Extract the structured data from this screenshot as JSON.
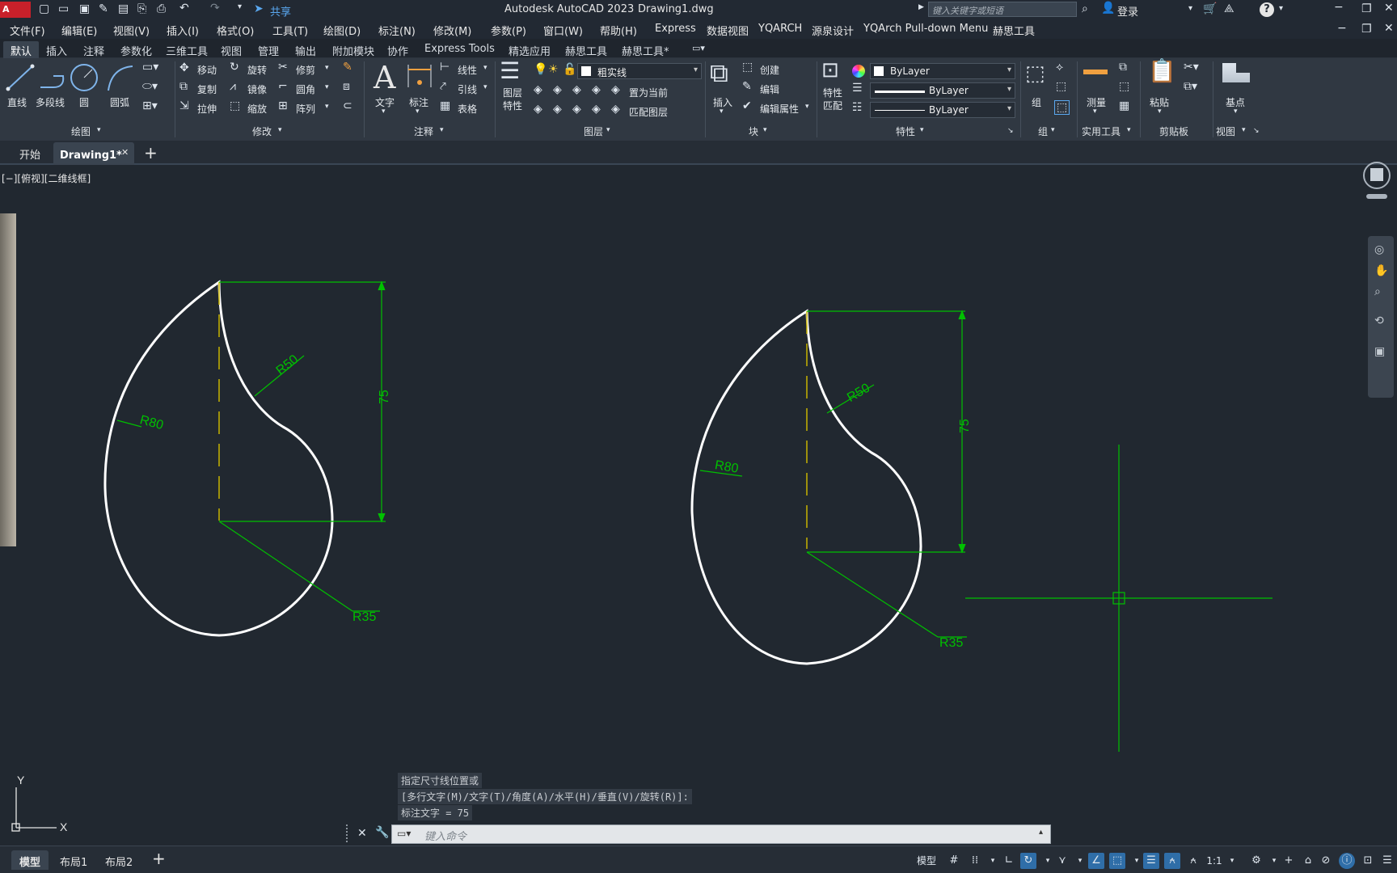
{
  "title_bar": {
    "app_logo": "A CAD",
    "share_label": "共享",
    "title": "Autodesk AutoCAD 2023",
    "document": "Drawing1.dwg",
    "search_placeholder": "键入关键字或短语",
    "login_label": "登录"
  },
  "menu": [
    "文件(F)",
    "编辑(E)",
    "视图(V)",
    "插入(I)",
    "格式(O)",
    "工具(T)",
    "绘图(D)",
    "标注(N)",
    "修改(M)",
    "参数(P)",
    "窗口(W)",
    "帮助(H)",
    "Express",
    "数据视图",
    "YQARCH",
    "源泉设计",
    "YQArch Pull-down Menu",
    "赫思工具"
  ],
  "ribbon_tabs": [
    "默认",
    "插入",
    "注释",
    "参数化",
    "三维工具",
    "视图",
    "管理",
    "输出",
    "附加模块",
    "协作",
    "Express Tools",
    "精选应用",
    "赫思工具",
    "赫思工具*"
  ],
  "ribbon": {
    "draw": {
      "line": "直线",
      "polyline": "多段线",
      "circle": "圆",
      "arc": "圆弧",
      "panel": "绘图"
    },
    "modify": {
      "move": "移动",
      "rotate": "旋转",
      "trim": "修剪",
      "copy": "复制",
      "mirror": "镜像",
      "fillet": "圆角",
      "stretch": "拉伸",
      "scale": "缩放",
      "array": "阵列",
      "panel": "修改"
    },
    "annotation": {
      "text": "文字",
      "dimension": "标注",
      "linear": "线性",
      "leader": "引线",
      "table": "表格",
      "panel": "注释"
    },
    "layers": {
      "properties_line1": "图层",
      "properties_line2": "特性",
      "current_layer": "粗实线",
      "set_current": "置为当前",
      "match_layer": "匹配图层",
      "panel": "图层"
    },
    "block": {
      "insert": "插入",
      "create": "创建",
      "edit": "编辑",
      "edit_attributes": "编辑属性",
      "panel": "块"
    },
    "properties": {
      "match_line1": "特性",
      "match_line2": "匹配",
      "color": "ByLayer",
      "linetype": "ByLayer",
      "lineweight": "ByLayer",
      "panel": "特性"
    },
    "groups": {
      "group": "组",
      "panel": "组"
    },
    "utilities": {
      "measure": "测量",
      "panel": "实用工具"
    },
    "clipboard": {
      "paste": "粘贴",
      "panel": "剪贴板"
    },
    "view": {
      "base": "基点",
      "panel": "视图"
    }
  },
  "doc_tabs": {
    "start": "开始",
    "drawing": "Drawing1*"
  },
  "viewport_label": "[−][俯视][二维线框]",
  "drawing_left": {
    "r50": "R50",
    "r80": "R80",
    "r35": "R35",
    "dim": "75"
  },
  "drawing_right": {
    "r50": "R50",
    "r80": "R80",
    "r35": "R35",
    "dim": "75"
  },
  "ucs": {
    "y": "Y",
    "x": "X"
  },
  "command_history": [
    "指定尺寸线位置或",
    "[多行文字(M)/文字(T)/角度(A)/水平(H)/垂直(V)/旋转(R)]:",
    "标注文字 = 75"
  ],
  "command_placeholder": "键入命令",
  "layout_tabs": [
    "模型",
    "布局1",
    "布局2"
  ],
  "status_bar": {
    "model": "模型",
    "scale": "1:1"
  },
  "colors": {
    "accent": "#2f6ea8",
    "dimension": "#00c000",
    "centerline": "#c8b400",
    "geometry": "#ffffff"
  }
}
